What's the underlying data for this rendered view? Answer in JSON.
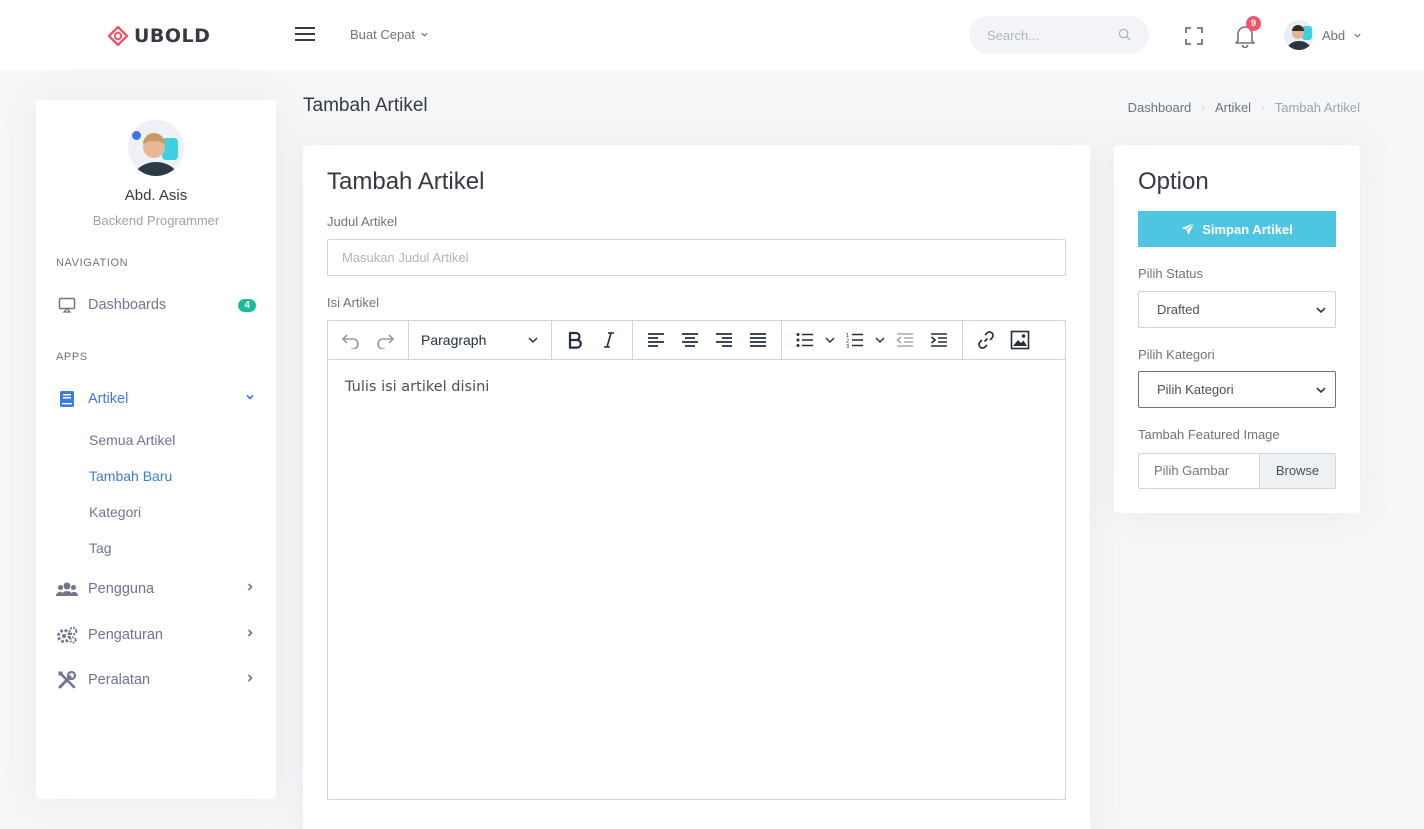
{
  "brand": {
    "name": "UBOLD",
    "accent": "#f1556c"
  },
  "topbar": {
    "quick_menu": "Buat Cepat",
    "search_placeholder": "Search...",
    "notification_count": "9",
    "user_name": "Abd"
  },
  "sidebar": {
    "profile": {
      "name": "Abd. Asis",
      "role": "Backend Programmer"
    },
    "nav_title": "NAVIGATION",
    "dashboards": {
      "label": "Dashboards",
      "badge": "4"
    },
    "apps_title": "APPS",
    "artikel": {
      "label": "Artikel",
      "sub_items": [
        "Semua Artikel",
        "Tambah Baru",
        "Kategori",
        "Tag"
      ]
    },
    "pengguna": {
      "label": "Pengguna"
    },
    "pengaturan": {
      "label": "Pengaturan"
    },
    "peralatan": {
      "label": "Peralatan"
    }
  },
  "page": {
    "title": "Tambah Artikel",
    "breadcrumb": [
      "Dashboard",
      "Artikel",
      "Tambah Artikel"
    ]
  },
  "form": {
    "card_title": "Tambah Artikel",
    "title_label": "Judul Artikel",
    "title_placeholder": "Masukan Judul Artikel",
    "content_label": "Isi Artikel",
    "paragraph_format": "Paragraph",
    "content_text": "Tulis isi artikel disini"
  },
  "options": {
    "title": "Option",
    "save_button": "Simpan Artikel",
    "status_label": "Pilih Status",
    "status_value": "Drafted",
    "category_label": "Pilih Kategori",
    "category_value": "Pilih Kategori",
    "image_label": "Tambah Featured Image",
    "image_placeholder": "Pilih Gambar",
    "browse_button": "Browse"
  }
}
